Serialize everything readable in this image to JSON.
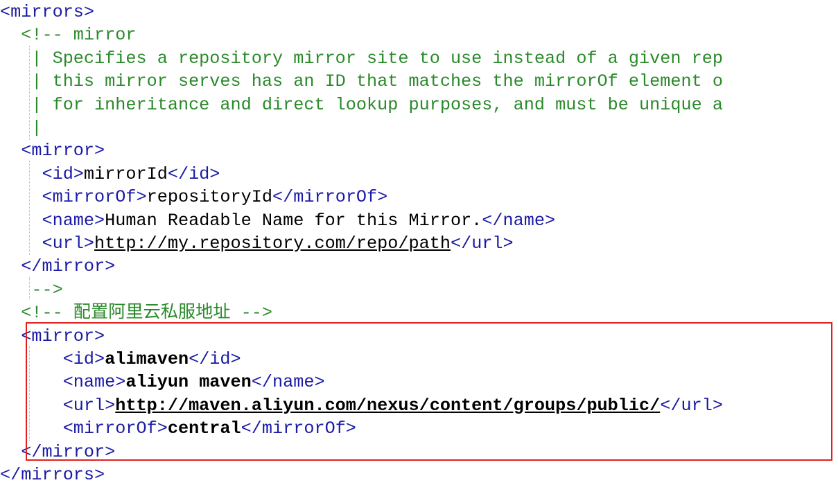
{
  "code_lines": [
    {
      "parts": [
        {
          "c": "tag",
          "t": "<mirrors>"
        }
      ]
    },
    {
      "parts": [
        {
          "c": "comment",
          "t": "  <!-- mirror"
        }
      ]
    },
    {
      "parts": [
        {
          "c": "comment",
          "t": "   | Specifies a repository mirror site to use instead of a given rep"
        }
      ]
    },
    {
      "parts": [
        {
          "c": "comment",
          "t": "   | this mirror serves has an ID that matches the mirrorOf element o"
        }
      ]
    },
    {
      "parts": [
        {
          "c": "comment",
          "t": "   | for inheritance and direct lookup purposes, and must be unique a"
        }
      ]
    },
    {
      "parts": [
        {
          "c": "comment",
          "t": "   |"
        }
      ]
    },
    {
      "parts": [
        {
          "c": "tag",
          "t": "  <mirror>"
        }
      ]
    },
    {
      "parts": [
        {
          "c": "tag",
          "t": "    <id>"
        },
        {
          "c": "text",
          "t": "mirrorId"
        },
        {
          "c": "tag",
          "t": "</id>"
        }
      ]
    },
    {
      "parts": [
        {
          "c": "tag",
          "t": "    <mirrorOf>"
        },
        {
          "c": "text",
          "t": "repositoryId"
        },
        {
          "c": "tag",
          "t": "</mirrorOf>"
        }
      ]
    },
    {
      "parts": [
        {
          "c": "tag",
          "t": "    <name>"
        },
        {
          "c": "text",
          "t": "Human Readable Name for this Mirror."
        },
        {
          "c": "tag",
          "t": "</name>"
        }
      ]
    },
    {
      "parts": [
        {
          "c": "tag",
          "t": "    <url>"
        },
        {
          "c": "text link",
          "t": "http://my.repository.com/repo/path"
        },
        {
          "c": "tag",
          "t": "</url>"
        }
      ]
    },
    {
      "parts": [
        {
          "c": "tag",
          "t": "  </mirror>"
        }
      ]
    },
    {
      "parts": [
        {
          "c": "comment",
          "t": "   -->"
        }
      ]
    },
    {
      "parts": [
        {
          "c": "comment",
          "t": "  <!-- 配置阿里云私服地址 -->"
        }
      ]
    },
    {
      "parts": [
        {
          "c": "tag",
          "t": "  <mirror>"
        }
      ]
    },
    {
      "parts": [
        {
          "c": "tag",
          "t": "      <id>"
        },
        {
          "c": "bold",
          "t": "alimaven"
        },
        {
          "c": "tag",
          "t": "</id>"
        }
      ]
    },
    {
      "parts": [
        {
          "c": "tag",
          "t": "      <name>"
        },
        {
          "c": "bold",
          "t": "aliyun maven"
        },
        {
          "c": "tag",
          "t": "</name>"
        }
      ]
    },
    {
      "parts": [
        {
          "c": "tag",
          "t": "      <url>"
        },
        {
          "c": "bold link",
          "t": "http://maven.aliyun.com/nexus/content/groups/public/"
        },
        {
          "c": "tag",
          "t": "</url>"
        }
      ]
    },
    {
      "parts": [
        {
          "c": "tag",
          "t": "      <mirrorOf>"
        },
        {
          "c": "bold",
          "t": "central"
        },
        {
          "c": "tag",
          "t": "</mirrorOf>"
        }
      ]
    },
    {
      "parts": [
        {
          "c": "tag",
          "t": "  </mirror>"
        }
      ]
    },
    {
      "parts": [
        {
          "c": "tag",
          "t": "</mirrors>"
        }
      ]
    }
  ],
  "colors": {
    "tag": "#1a1aa6",
    "comment": "#2a8a2a",
    "text": "#000000",
    "highlight_border": "#e02020"
  }
}
